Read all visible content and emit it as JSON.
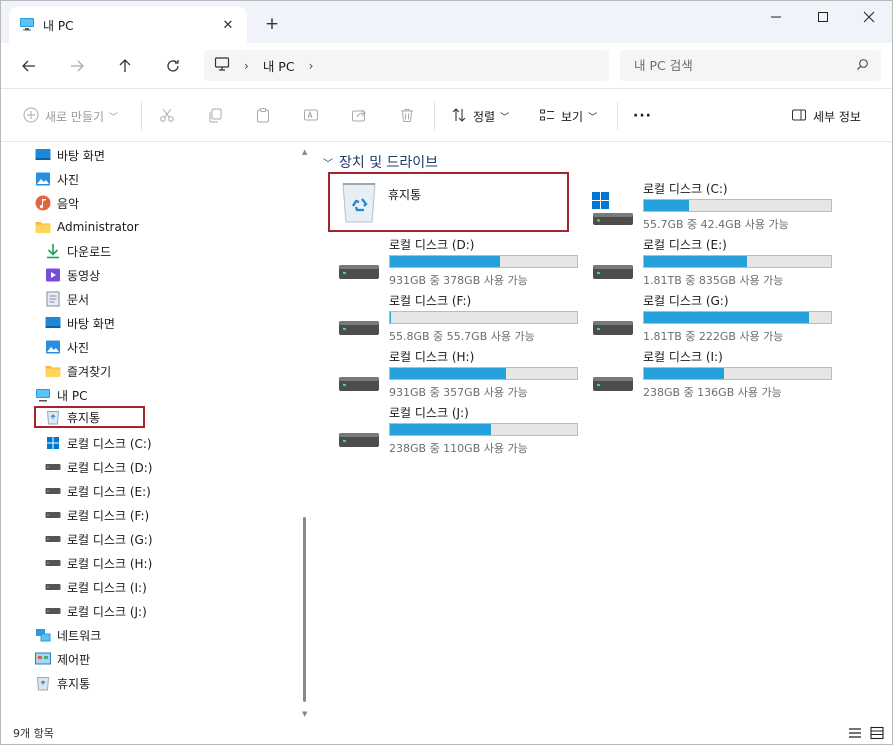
{
  "window": {
    "tab_title": "내 PC",
    "new_tab": "+"
  },
  "address": {
    "crumbs": [
      "내 PC"
    ],
    "search_placeholder": "내 PC 검색"
  },
  "toolbar": {
    "new_label": "새로 만들기",
    "sort_label": "정렬",
    "view_label": "보기",
    "more_label": "···",
    "details_label": "세부 정보"
  },
  "sidebar": {
    "items": [
      {
        "label": "바탕 화면",
        "icon": "desktop-icon"
      },
      {
        "label": "사진",
        "icon": "pictures-icon"
      },
      {
        "label": "음악",
        "icon": "music-icon"
      },
      {
        "label": "Administrator",
        "icon": "folder-icon"
      },
      {
        "label": "다운로드",
        "icon": "download-icon"
      },
      {
        "label": "동영상",
        "icon": "video-icon"
      },
      {
        "label": "문서",
        "icon": "document-icon"
      },
      {
        "label": "바탕 화면",
        "icon": "desktop-icon"
      },
      {
        "label": "사진",
        "icon": "pictures-icon"
      },
      {
        "label": "즐겨찾기",
        "icon": "folder-icon"
      },
      {
        "label": "내 PC",
        "icon": "monitor-icon"
      },
      {
        "label": "휴지통",
        "icon": "recycle-bin-icon"
      },
      {
        "label": "로컬 디스크 (C:)",
        "icon": "windows-drive-icon"
      },
      {
        "label": "로컬 디스크 (D:)",
        "icon": "drive-icon"
      },
      {
        "label": "로컬 디스크 (E:)",
        "icon": "drive-icon"
      },
      {
        "label": "로컬 디스크 (F:)",
        "icon": "drive-icon"
      },
      {
        "label": "로컬 디스크 (G:)",
        "icon": "drive-icon"
      },
      {
        "label": "로컬 디스크 (H:)",
        "icon": "drive-icon"
      },
      {
        "label": "로컬 디스크 (I:)",
        "icon": "drive-icon"
      },
      {
        "label": "로컬 디스크 (J:)",
        "icon": "drive-icon"
      },
      {
        "label": "네트워크",
        "icon": "network-icon"
      },
      {
        "label": "제어판",
        "icon": "control-panel-icon"
      },
      {
        "label": "휴지통",
        "icon": "recycle-bin-icon"
      }
    ]
  },
  "content": {
    "group_title": "장치 및 드라이브",
    "recycle_bin_label": "휴지통",
    "drives": [
      {
        "name": "로컬 디스크 (C:)",
        "free": "55.7GB 중 42.4GB 사용 가능",
        "used_fraction": 0.24,
        "windows": true
      },
      {
        "name": "로컬 디스크 (D:)",
        "free": "931GB 중 378GB 사용 가능",
        "used_fraction": 0.59
      },
      {
        "name": "로컬 디스크 (E:)",
        "free": "1.81TB 중 835GB 사용 가능",
        "used_fraction": 0.55
      },
      {
        "name": "로컬 디스크 (F:)",
        "free": "55.8GB 중 55.7GB 사용 가능",
        "used_fraction": 0.002
      },
      {
        "name": "로컬 디스크 (G:)",
        "free": "1.81TB 중 222GB 사용 가능",
        "used_fraction": 0.88
      },
      {
        "name": "로컬 디스크 (H:)",
        "free": "931GB 중 357GB 사용 가능",
        "used_fraction": 0.62
      },
      {
        "name": "로컬 디스크 (I:)",
        "free": "238GB 중 136GB 사용 가능",
        "used_fraction": 0.43
      },
      {
        "name": "로컬 디스크 (J:)",
        "free": "238GB 중 110GB 사용 가능",
        "used_fraction": 0.54
      }
    ]
  },
  "status": {
    "item_count": "9개 항목"
  },
  "colors": {
    "accent": "#26a0da",
    "selection_border": "#a4262c",
    "group_title": "#1f3b67"
  }
}
